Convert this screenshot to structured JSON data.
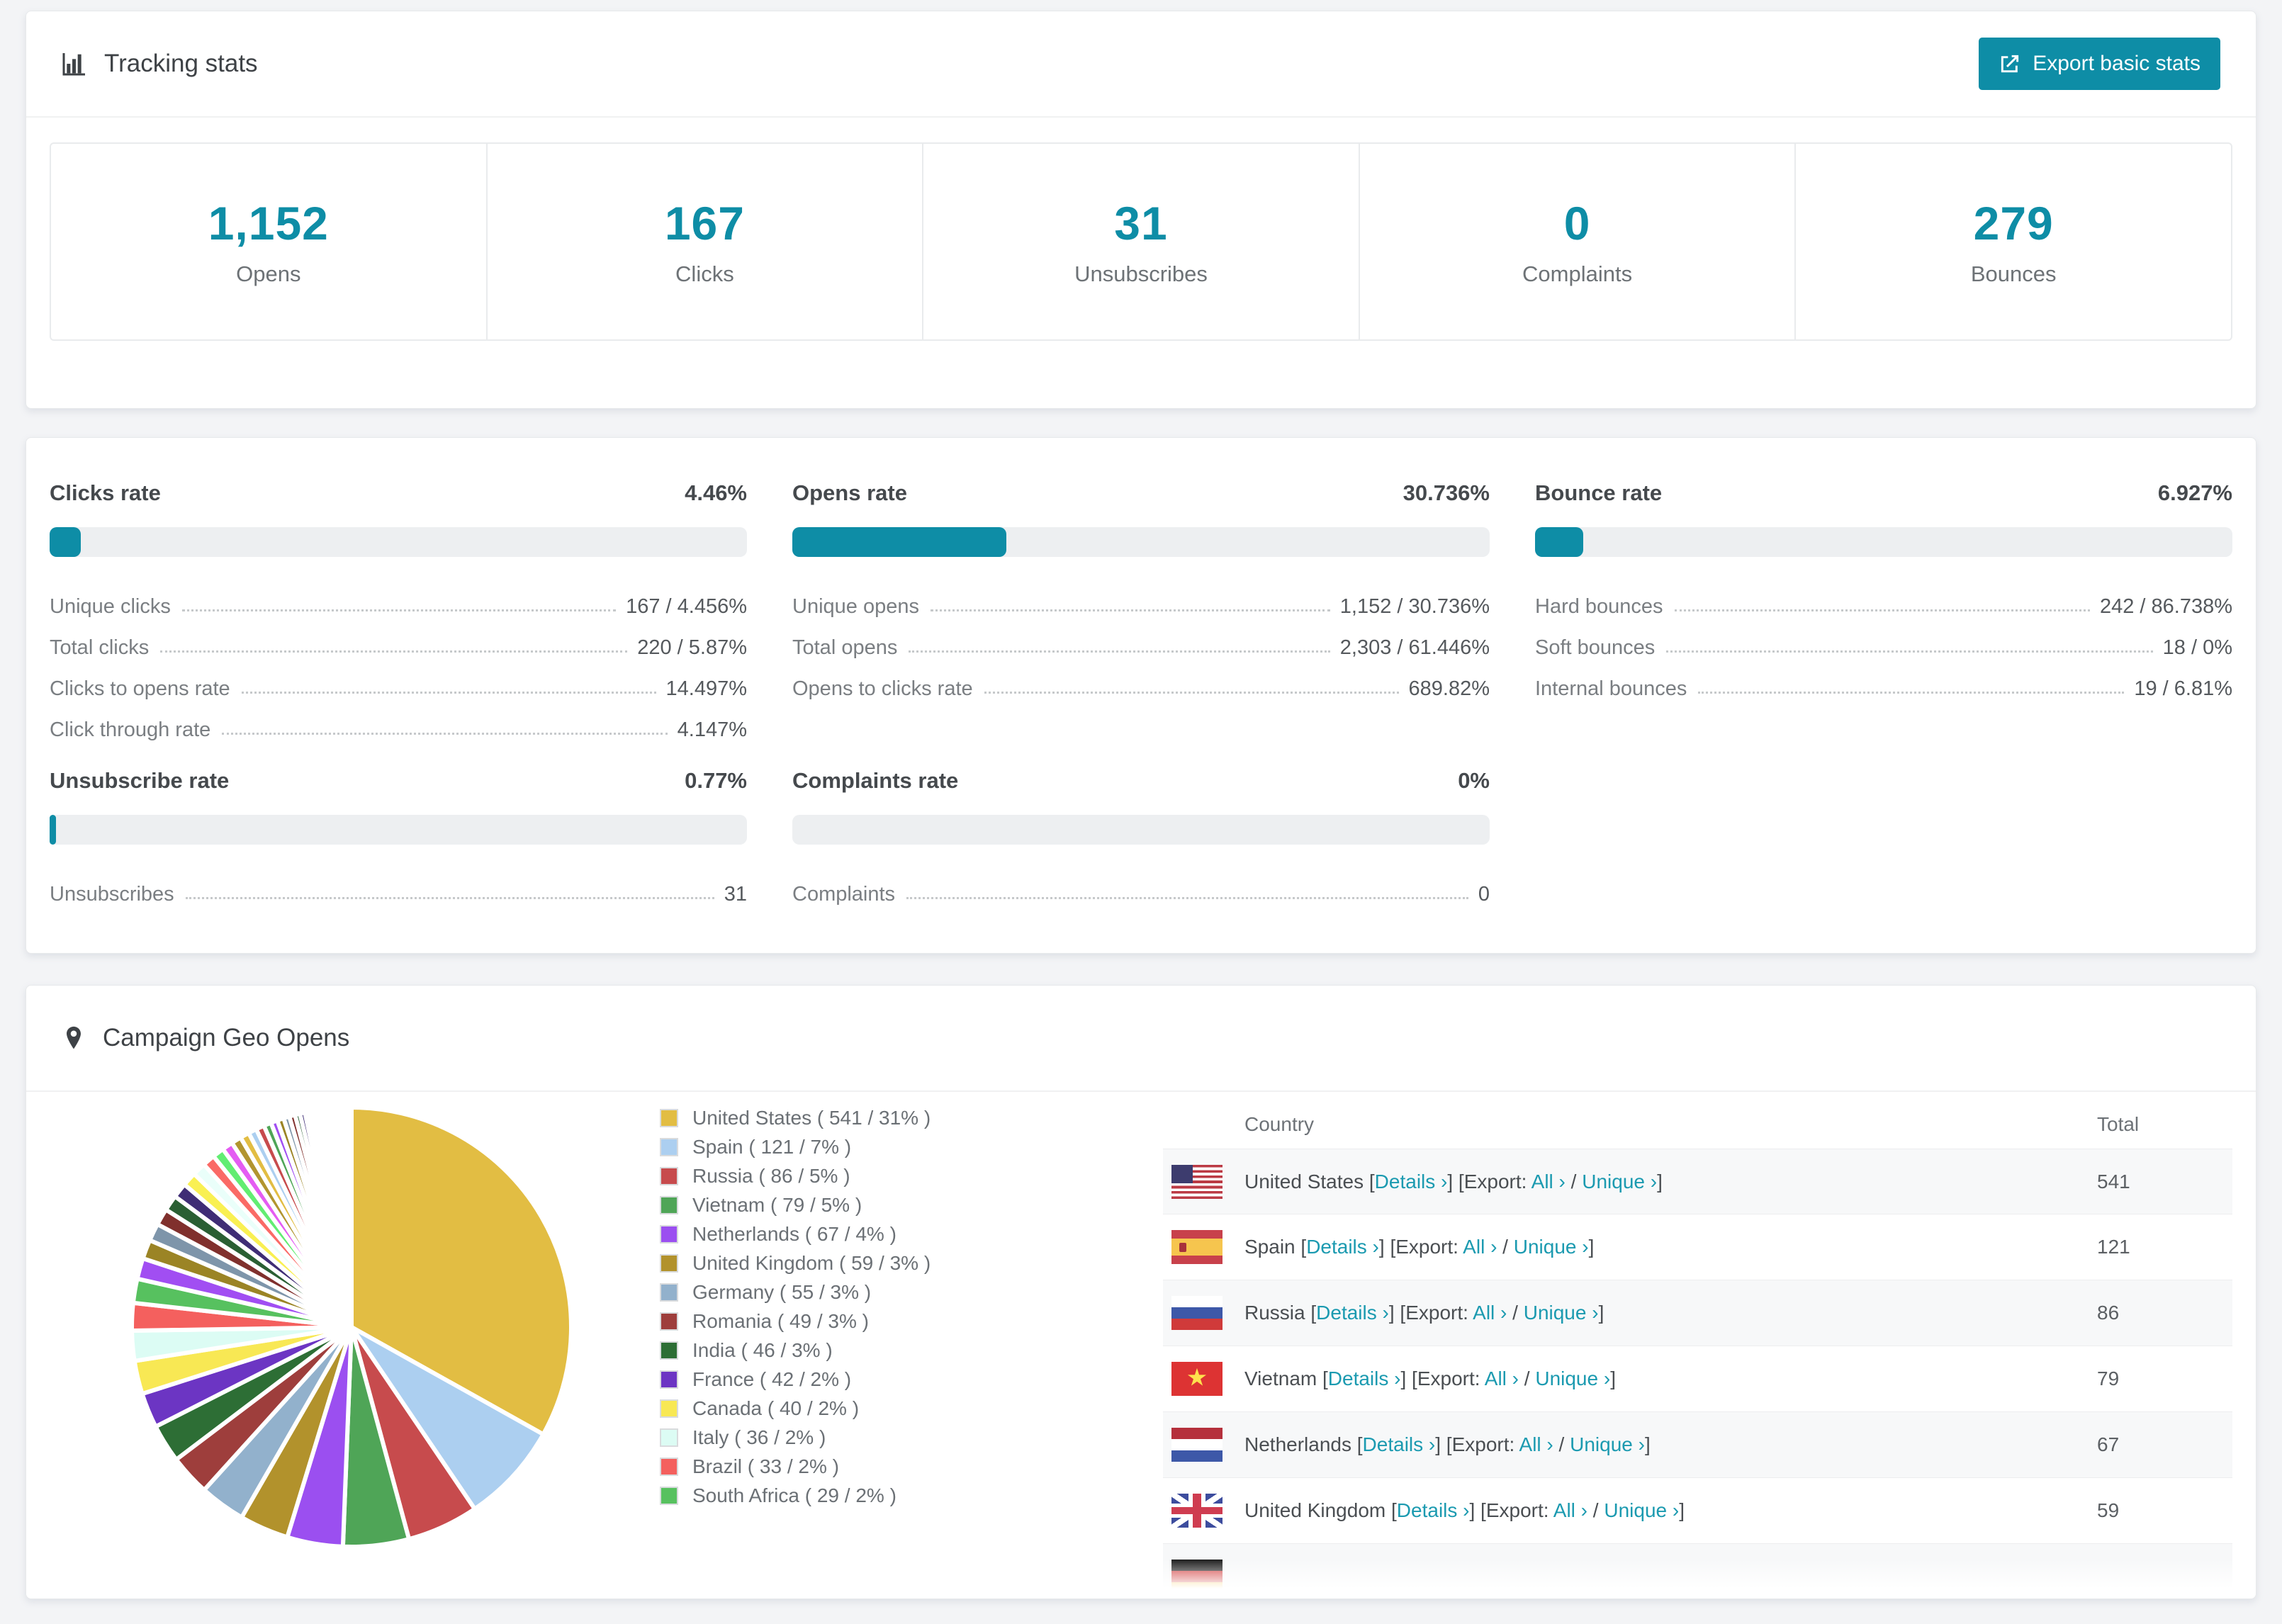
{
  "page": {
    "background": "#f3f4f6",
    "accent": "#0e8da6",
    "link_color": "#1b9ab0"
  },
  "tracking": {
    "title": "Tracking stats",
    "export_label": "Export basic stats",
    "stats": [
      {
        "value": "1,152",
        "label": "Opens"
      },
      {
        "value": "167",
        "label": "Clicks"
      },
      {
        "value": "31",
        "label": "Unsubscribes"
      },
      {
        "value": "0",
        "label": "Complaints"
      },
      {
        "value": "279",
        "label": "Bounces"
      }
    ]
  },
  "rates": [
    {
      "title": "Clicks rate",
      "value": "4.46%",
      "bar_pct": 4.46,
      "rows": [
        {
          "label": "Unique clicks",
          "value": "167 / 4.456%"
        },
        {
          "label": "Total clicks",
          "value": "220 / 5.87%"
        },
        {
          "label": "Clicks to opens rate",
          "value": "14.497%"
        },
        {
          "label": "Click through rate",
          "value": "4.147%"
        }
      ]
    },
    {
      "title": "Opens rate",
      "value": "30.736%",
      "bar_pct": 30.736,
      "rows": [
        {
          "label": "Unique opens",
          "value": "1,152 / 30.736%"
        },
        {
          "label": "Total opens",
          "value": "2,303 / 61.446%"
        },
        {
          "label": "Opens to clicks rate",
          "value": "689.82%"
        }
      ]
    },
    {
      "title": "Bounce rate",
      "value": "6.927%",
      "bar_pct": 6.927,
      "rows": [
        {
          "label": "Hard bounces",
          "value": "242 / 86.738%"
        },
        {
          "label": "Soft bounces",
          "value": "18 / 0%"
        },
        {
          "label": "Internal bounces",
          "value": "19 / 6.81%"
        }
      ]
    },
    {
      "title": "Unsubscribe rate",
      "value": "0.77%",
      "bar_pct": 0.77,
      "rows": [
        {
          "label": "Unsubscribes",
          "value": "31"
        }
      ]
    },
    {
      "title": "Complaints rate",
      "value": "0%",
      "bar_pct": 0,
      "rows": [
        {
          "label": "Complaints",
          "value": "0"
        }
      ]
    }
  ],
  "geo": {
    "title": "Campaign Geo Opens",
    "table": {
      "col_country": "Country",
      "col_total": "Total",
      "details_label": "Details ›",
      "export_label": "Export:",
      "all_label": "All ›",
      "unique_label": "Unique ›",
      "rows": [
        {
          "flag": "us",
          "country": "United States",
          "total": "541"
        },
        {
          "flag": "es",
          "country": "Spain",
          "total": "121"
        },
        {
          "flag": "ru",
          "country": "Russia",
          "total": "86"
        },
        {
          "flag": "vn",
          "country": "Vietnam",
          "total": "79"
        },
        {
          "flag": "nl",
          "country": "Netherlands",
          "total": "67"
        },
        {
          "flag": "gb",
          "country": "United Kingdom",
          "total": "59"
        },
        {
          "flag": "de",
          "country": "",
          "total": ""
        }
      ]
    }
  },
  "chart_data": {
    "type": "pie",
    "title": "Campaign Geo Opens",
    "legend_position": "right",
    "start_angle": -90,
    "direction": "clockwise",
    "series": [
      {
        "name": "United States",
        "value": 541,
        "pct": "31%",
        "color": "#e2bd43"
      },
      {
        "name": "Spain",
        "value": 121,
        "pct": "7%",
        "color": "#accff0"
      },
      {
        "name": "Russia",
        "value": 86,
        "pct": "5%",
        "color": "#c74b4d"
      },
      {
        "name": "Vietnam",
        "value": 79,
        "pct": "5%",
        "color": "#4fa557"
      },
      {
        "name": "Netherlands",
        "value": 67,
        "pct": "4%",
        "color": "#9b4ff0"
      },
      {
        "name": "United Kingdom",
        "value": 59,
        "pct": "3%",
        "color": "#b2922c"
      },
      {
        "name": "Germany",
        "value": 55,
        "pct": "3%",
        "color": "#92b1cc"
      },
      {
        "name": "Romania",
        "value": 49,
        "pct": "3%",
        "color": "#9e3e3c"
      },
      {
        "name": "India",
        "value": 46,
        "pct": "3%",
        "color": "#2d6e35"
      },
      {
        "name": "France",
        "value": 42,
        "pct": "2%",
        "color": "#6c35c3"
      },
      {
        "name": "Canada",
        "value": 40,
        "pct": "2%",
        "color": "#f8e854"
      },
      {
        "name": "Italy",
        "value": 36,
        "pct": "2%",
        "color": "#dcfcf4"
      },
      {
        "name": "Brazil",
        "value": 33,
        "pct": "2%",
        "color": "#f4605e"
      },
      {
        "name": "South Africa",
        "value": 29,
        "pct": "2%",
        "color": "#57c15f"
      }
    ],
    "other_slices": [
      25,
      23,
      21,
      20,
      19,
      18,
      17,
      16,
      15,
      14,
      13,
      12,
      11,
      10,
      10,
      9,
      8,
      8,
      7,
      7,
      6,
      6,
      5,
      5,
      4,
      4,
      4,
      3,
      3,
      3,
      3,
      2,
      2,
      2,
      2,
      2,
      1.5,
      1.5,
      1.2,
      1,
      1,
      0.8,
      0.8,
      0.6,
      0.6,
      0.5,
      0.4,
      0.4,
      0.3,
      0.3,
      0.2,
      0.2,
      0.15,
      0.1,
      0.1
    ],
    "tail_palette": [
      "#a14ef2",
      "#9b8425",
      "#7e95aa",
      "#80302d",
      "#2a5f33",
      "#3f2d75",
      "#f9f052",
      "#eafffa",
      "#fa6a66",
      "#62ed72",
      "#e45cf2",
      "#b2952f",
      "#e2bd43",
      "#accff0",
      "#c74b4d",
      "#4fa557"
    ]
  }
}
